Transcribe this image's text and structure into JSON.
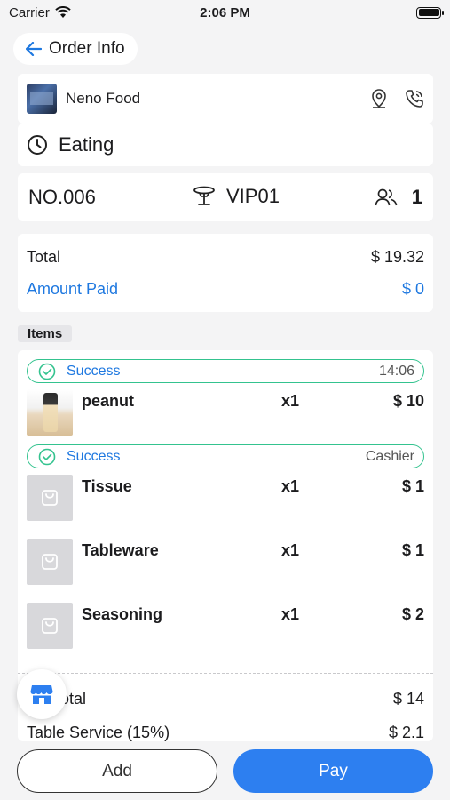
{
  "status_bar": {
    "carrier": "Carrier",
    "time": "2:06 PM"
  },
  "header": {
    "back_label": "Order Info"
  },
  "store": {
    "name": "Neno Food"
  },
  "order_status": {
    "label": "Eating"
  },
  "order": {
    "number": "NO.006",
    "table": "VIP01",
    "guests": "1"
  },
  "totals": {
    "total_label": "Total",
    "total_value": "$ 19.32",
    "paid_label": "Amount Paid",
    "paid_value": "$ 0"
  },
  "items_section": {
    "label": "Items"
  },
  "batches": [
    {
      "status": "Success",
      "right": "14:06",
      "items": [
        {
          "name": "peanut",
          "qty": "x1",
          "price": "$ 10"
        }
      ]
    },
    {
      "status": "Success",
      "right": "Cashier",
      "items": [
        {
          "name": "Tissue",
          "qty": "x1",
          "price": "$ 1"
        },
        {
          "name": "Tableware",
          "qty": "x1",
          "price": "$ 1"
        },
        {
          "name": "Seasoning",
          "qty": "x1",
          "price": "$ 2"
        }
      ]
    }
  ],
  "summary": {
    "subtotal_label": "otal",
    "subtotal_value": "$ 14",
    "service_label": "Table Service (15%)",
    "service_value": "$ 2.1"
  },
  "actions": {
    "add_label": "Add",
    "pay_label": "Pay"
  },
  "colors": {
    "accent": "#2d7ff0",
    "success": "#34c38f",
    "link": "#1e78e0"
  }
}
